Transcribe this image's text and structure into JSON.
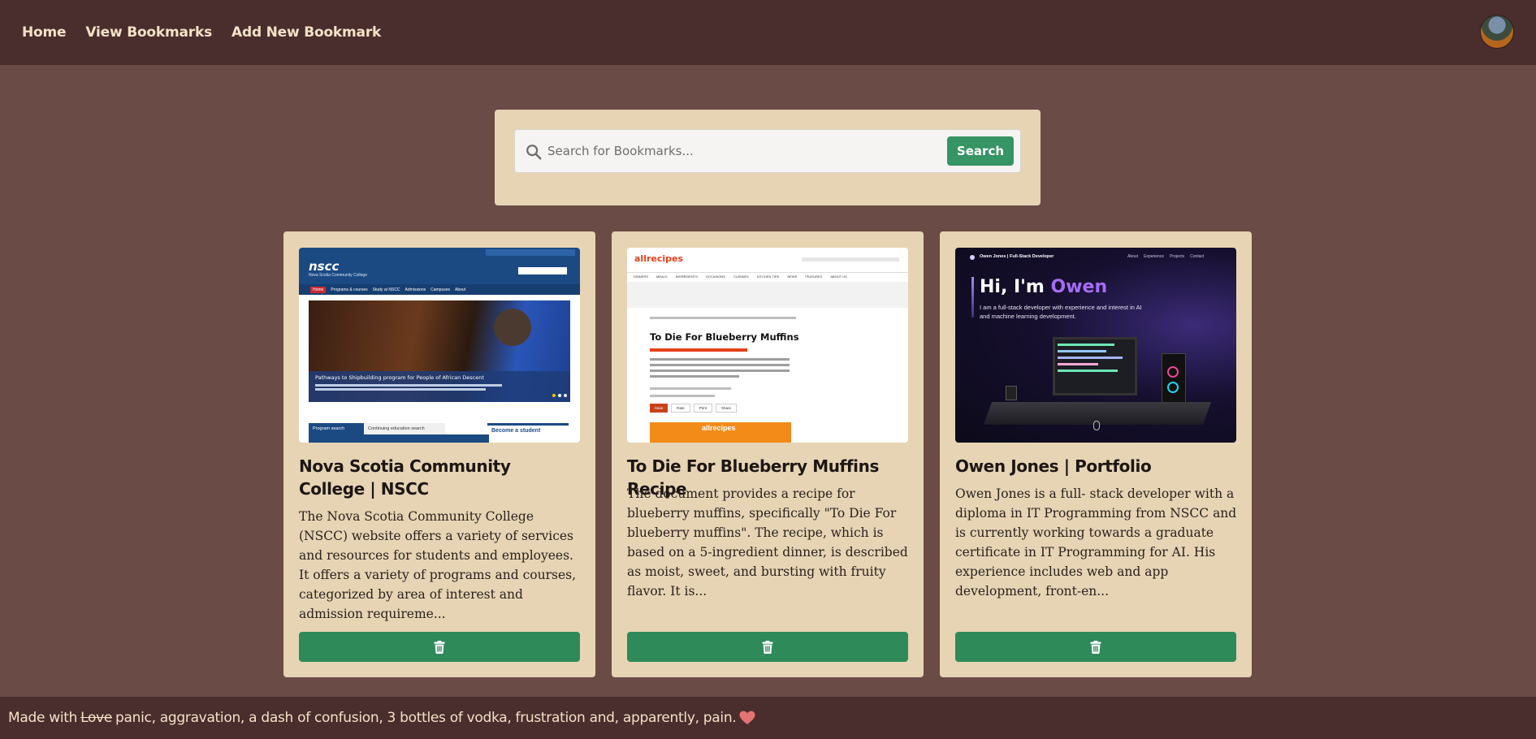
{
  "nav": {
    "links": [
      "Home",
      "View Bookmarks",
      "Add New Bookmark"
    ]
  },
  "search": {
    "placeholder": "Search for Bookmarks...",
    "button_label": "Search"
  },
  "cards": [
    {
      "title": "Nova Scotia Community College | NSCC",
      "description": "The Nova Scotia Community College (NSCC) website offers a variety of services and resources for students and employees. It offers a variety of programs and courses, categorized by area of interest and admission requireme...",
      "screenshot": {
        "logo": "nscc",
        "subtitle": "Nova Scotia Community College",
        "menu": [
          "Home",
          "Programs & courses",
          "Study at NSCC",
          "Admissions",
          "Campuses",
          "About"
        ],
        "banner": "Pathways to Shipbuilding program for People of African Descent",
        "tabs": [
          "Program search",
          "Continuing education search"
        ],
        "cta": "Become a student"
      }
    },
    {
      "title": "To Die For Blueberry Muffins Recipe",
      "description": "The document provides a recipe for blueberry muffins, specifically \"To Die For blueberry muffins\". The recipe, which is based on a 5-ingredient dinner, is described as moist, sweet, and bursting with fruity flavor. It is...",
      "screenshot": {
        "logo": "allrecipes",
        "menu": [
          "DINNERS",
          "MEALS",
          "INGREDIENTS",
          "OCCASIONS",
          "CUISINES",
          "KITCHEN TIPS",
          "NEWS",
          "FEATURES",
          "ABOUT US"
        ],
        "heading": "To Die For Blueberry Muffins",
        "buttons": [
          "Save",
          "Rate",
          "Print",
          "Share"
        ]
      }
    },
    {
      "title": "Owen Jones | Portfolio",
      "description": "Owen Jones is a full- stack developer with a diploma in IT Programming from NSCC and is currently working towards a graduate certificate in IT Programming for AI. His experience includes web and app development, front-en...",
      "screenshot": {
        "site_name": "Owen Jones | Full-Stack Developer",
        "menu": [
          "About",
          "Experience",
          "Projects",
          "Contact"
        ],
        "greeting": "Hi, I'm",
        "name": "Owen",
        "tagline": "I am a full-stack developer with experience and interest in AI and machine learning development."
      }
    }
  ],
  "footer": {
    "prefix": "Made with",
    "struck": "Love",
    "rest": "panic, aggravation, a dash of confusion, 3 bottles of vodka, frustration and, apparently, pain.",
    "heart_icon": "heart-icon"
  },
  "colors": {
    "navbar": "#4a2d2d",
    "background": "#6b4b45",
    "panel": "#e6d4b4",
    "accent_green": "#369465",
    "nav_text": "#f3e2c6",
    "heart": "#e57373"
  }
}
